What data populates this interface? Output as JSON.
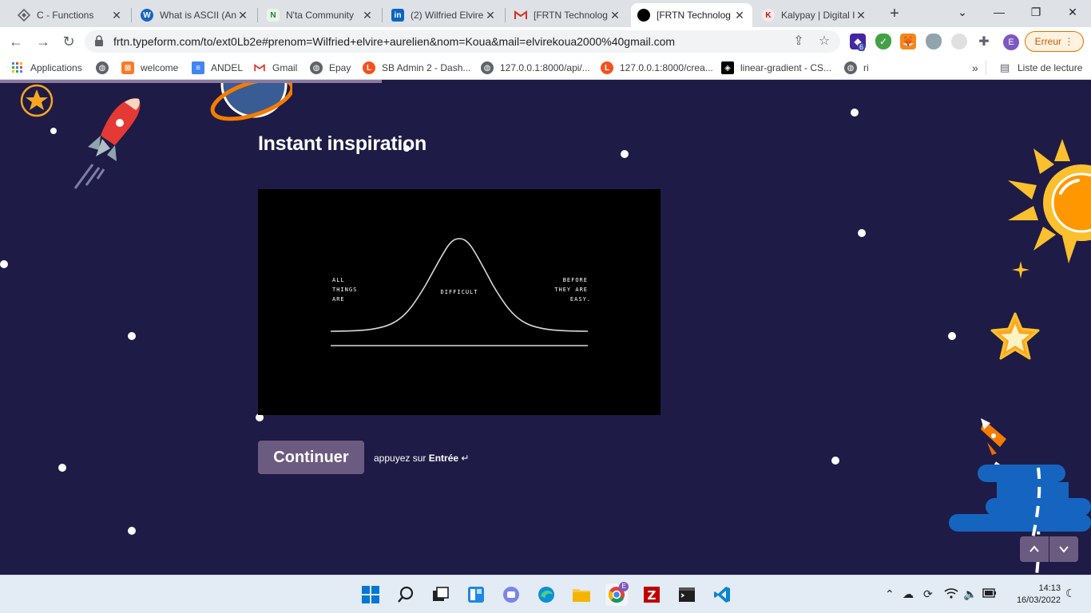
{
  "browser": {
    "tabs": [
      {
        "title": "C - Functions",
        "icon": "codeblocks-icon",
        "color": "#5f6368",
        "active": false
      },
      {
        "title": "What is ASCII (An",
        "icon": "wordpress-icon",
        "color": "#1565c0",
        "active": false
      },
      {
        "title": "N'ta Community",
        "icon": "nta-icon",
        "color": "#2e7d32",
        "active": false
      },
      {
        "title": "(2) Wilfried Elvire",
        "icon": "linkedin-icon",
        "color": "#0a66c2",
        "active": false
      },
      {
        "title": "[FRTN Technolog",
        "icon": "gmail-icon",
        "color": "#d93025",
        "active": false
      },
      {
        "title": "[FRTN Technolog",
        "icon": "typeform-icon",
        "color": "#000000",
        "active": true
      },
      {
        "title": "Kalypay | Digital I",
        "icon": "kalypay-icon",
        "color": "#b71c1c",
        "active": false
      }
    ],
    "url": "frtn.typeform.com/to/ext0Lb2e#prenom=Wilfried+elvire+aurelien&nom=Koua&mail=elvirekoua2000%40gmail.com",
    "extension_badge": "6",
    "profile_initial": "E",
    "error_button": "Erreur",
    "bookmarks": [
      {
        "label": "Applications",
        "icon": "apps-grid-icon"
      },
      {
        "label": "",
        "icon": "globe-icon"
      },
      {
        "label": "welcome",
        "icon": "xampp-icon"
      },
      {
        "label": "ANDEL",
        "icon": "docs-icon"
      },
      {
        "label": "Gmail",
        "icon": "gmail-icon"
      },
      {
        "label": "Epay",
        "icon": "globe-icon"
      },
      {
        "label": "SB Admin 2 - Dash...",
        "icon": "laravel-icon"
      },
      {
        "label": "127.0.0.1:8000/api/...",
        "icon": "globe-icon"
      },
      {
        "label": "127.0.0.1:8000/crea...",
        "icon": "laravel-icon"
      },
      {
        "label": "linear-gradient - CS...",
        "icon": "codepen-icon"
      },
      {
        "label": "ri",
        "icon": "globe-icon"
      }
    ],
    "bookmarks_overflow": "»",
    "reading_list": "Liste de lecture"
  },
  "form": {
    "heading": "Instant inspiration",
    "image_text": {
      "left": [
        "ALL",
        "THINGS",
        "ARE"
      ],
      "center": "DIFFICULT",
      "right": [
        "BEFORE",
        "THEY ARE",
        "EASY."
      ]
    },
    "continue_label": "Continuer",
    "hint_prefix": "appuyez sur ",
    "hint_key": "Entrée",
    "hint_symbol": "↵",
    "progress_fraction": 0.35
  },
  "taskbar": {
    "time": "14:13",
    "date": "16/03/2022"
  },
  "colors": {
    "page_bg": "#1e1b46",
    "button": "#6c5b80",
    "accent_orange": "#f5a623"
  }
}
